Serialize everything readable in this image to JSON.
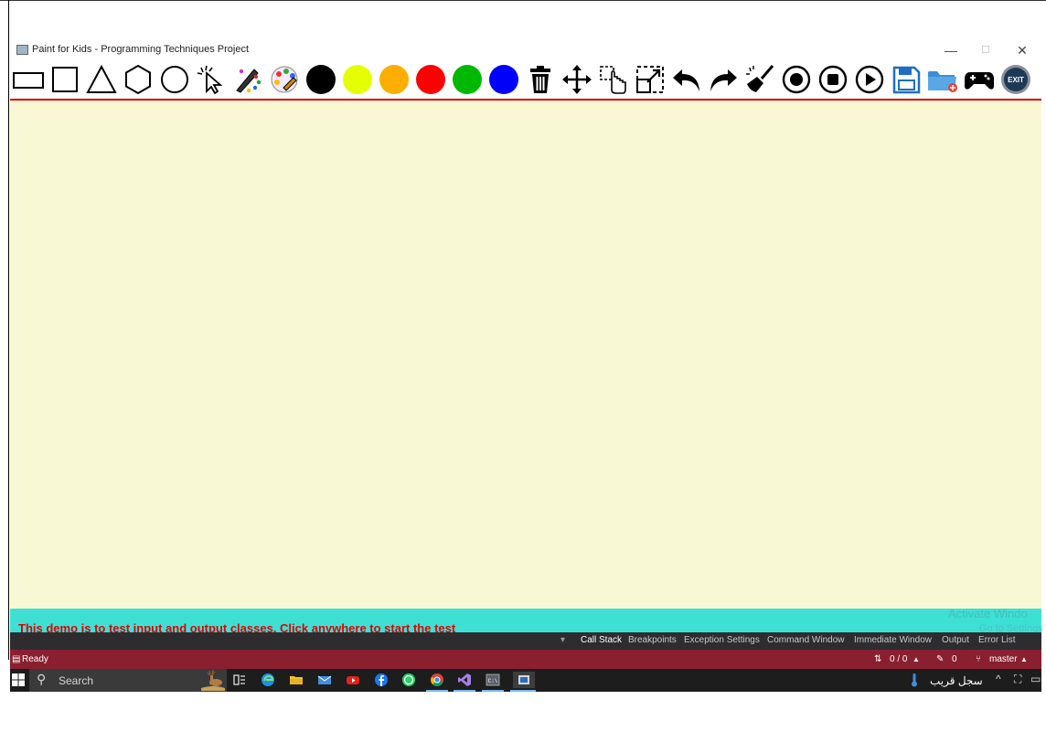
{
  "window": {
    "title": "Paint for Kids - Programming Techniques Project",
    "minimize": "—",
    "maximize": "☐",
    "close": "✕"
  },
  "toolbar": {
    "items": [
      {
        "name": "rectangle-tool-icon"
      },
      {
        "name": "square-tool-icon"
      },
      {
        "name": "triangle-tool-icon"
      },
      {
        "name": "hexagon-tool-icon"
      },
      {
        "name": "circle-tool-icon"
      },
      {
        "name": "select-tool-icon"
      },
      {
        "name": "draw-color-icon"
      },
      {
        "name": "fill-color-icon"
      },
      {
        "name": "color-black",
        "color": "#000000"
      },
      {
        "name": "color-yellow",
        "color": "#e6ff00"
      },
      {
        "name": "color-orange",
        "color": "#ffae00"
      },
      {
        "name": "color-red",
        "color": "#ff0000"
      },
      {
        "name": "color-green",
        "color": "#00b800"
      },
      {
        "name": "color-blue",
        "color": "#0000ff"
      },
      {
        "name": "delete-icon"
      },
      {
        "name": "move-icon"
      },
      {
        "name": "drag-move-icon"
      },
      {
        "name": "resize-icon"
      },
      {
        "name": "undo-icon"
      },
      {
        "name": "redo-icon"
      },
      {
        "name": "clear-all-icon"
      },
      {
        "name": "start-recording-icon"
      },
      {
        "name": "stop-recording-icon"
      },
      {
        "name": "play-recording-icon"
      },
      {
        "name": "save-icon"
      },
      {
        "name": "load-icon"
      },
      {
        "name": "play-mode-icon"
      },
      {
        "name": "exit-icon",
        "label": "EXIT"
      }
    ]
  },
  "statusbar": {
    "message": "This demo is to test input and output classes, Click anywhere to start the test",
    "watermark": "Activate Windo",
    "watermark_sub": "Go to Settings to"
  },
  "vs_tabs": [
    "Call Stack",
    "Breakpoints",
    "Exception Settings",
    "Command Window",
    "Immediate Window",
    "Output",
    "Error List"
  ],
  "vs_status": {
    "ready": "Ready",
    "changes": "0 / 0",
    "edits": "0",
    "branch": "master"
  },
  "taskbar": {
    "search_placeholder": "Search",
    "weather_text": "سجل قريب"
  },
  "colors": {
    "canvas": "#f8f8d4",
    "statusbar": "#3ee0d4",
    "status_text": "#e00000",
    "toolbar_line": "#d40000",
    "vs_status": "#8a1f2f"
  }
}
